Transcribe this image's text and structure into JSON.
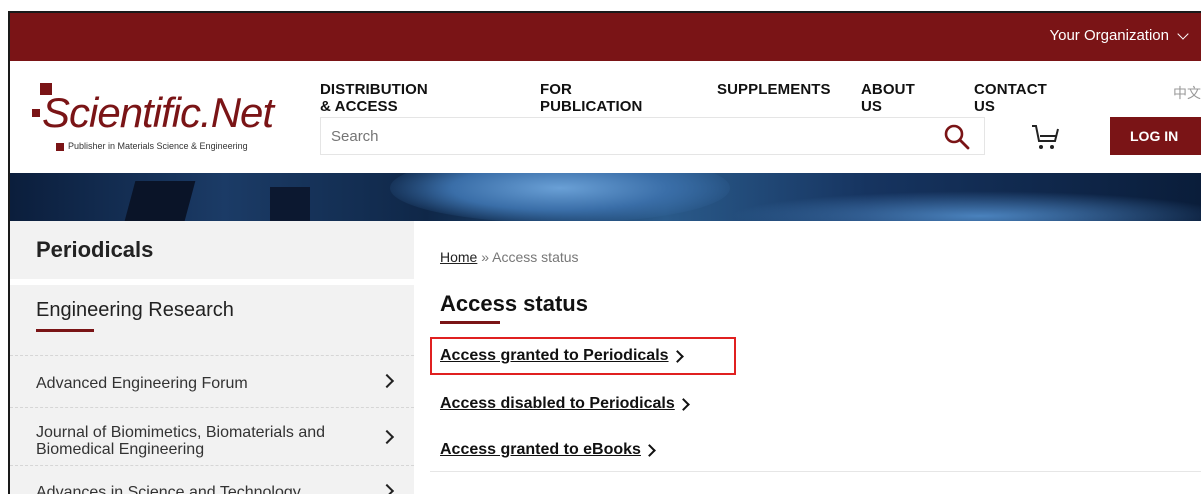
{
  "topbar": {
    "org_label": "Your Organization"
  },
  "logo": {
    "name": "Scientific.Net",
    "tagline": "Publisher in Materials Science & Engineering"
  },
  "nav": [
    {
      "label": "DISTRIBUTION & ACCESS"
    },
    {
      "label": "FOR PUBLICATION"
    },
    {
      "label": "SUPPLEMENTS"
    },
    {
      "label": "ABOUT US"
    },
    {
      "label": "CONTACT US"
    }
  ],
  "lang": "中文",
  "search": {
    "placeholder": "Search"
  },
  "login_label": "LOG IN",
  "sidebar": {
    "title": "Periodicals",
    "category": "Engineering Research",
    "items": [
      {
        "label": "Advanced Engineering Forum"
      },
      {
        "label": "Journal of Biomimetics, Biomaterials and Biomedical Engineering"
      },
      {
        "label": "Advances in Science and Technology"
      }
    ]
  },
  "breadcrumb": {
    "home": "Home",
    "separator": "»",
    "current": "Access status"
  },
  "main": {
    "title": "Access status",
    "links": [
      {
        "label": "Access granted to Periodicals"
      },
      {
        "label": "Access disabled to Periodicals"
      },
      {
        "label": "Access granted to eBooks"
      }
    ]
  },
  "colors": {
    "brand": "#7a1416",
    "highlight": "#e02020"
  }
}
